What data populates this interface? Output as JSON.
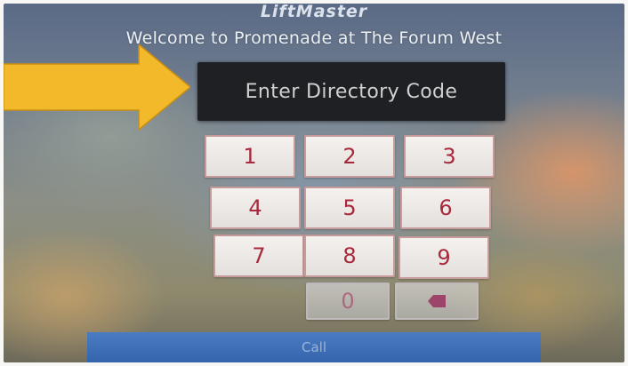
{
  "header": {
    "brand": "LiftMaster",
    "welcome": "Welcome to Promenade at The Forum West"
  },
  "code_field": {
    "placeholder": "Enter Directory Code"
  },
  "keypad": {
    "keys": [
      "1",
      "2",
      "3",
      "4",
      "5",
      "6",
      "7",
      "8",
      "9",
      "0"
    ],
    "backspace_icon": "backspace-icon"
  },
  "call_button": {
    "label": "Call"
  },
  "colors": {
    "arrow": "#f2b92a",
    "key_text": "#a8283c",
    "code_field_bg": "#1f2024",
    "call_bar": "#3a6cb4"
  }
}
